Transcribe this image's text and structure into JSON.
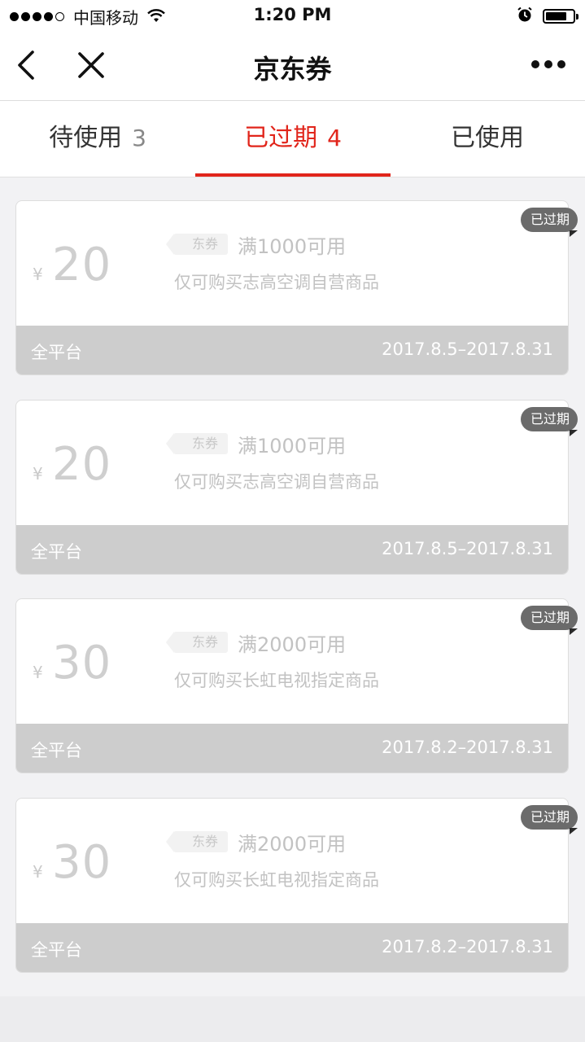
{
  "status_bar": {
    "carrier": "中国移动",
    "time": "1:20 PM"
  },
  "nav": {
    "title": "京东券"
  },
  "tabs": [
    {
      "label": "待使用",
      "count": "3",
      "active": false
    },
    {
      "label": "已过期",
      "count": "4",
      "active": true
    },
    {
      "label": "已使用",
      "count": "",
      "active": false
    }
  ],
  "coupons": [
    {
      "currency": "¥",
      "amount": "20",
      "tag": "东券",
      "condition": "满1000可用",
      "description": "仅可购买志高空调自营商品",
      "platform": "全平台",
      "period": "2017.8.5–2017.8.31",
      "badge": "已过期"
    },
    {
      "currency": "¥",
      "amount": "20",
      "tag": "东券",
      "condition": "满1000可用",
      "description": "仅可购买志高空调自营商品",
      "platform": "全平台",
      "period": "2017.8.5–2017.8.31",
      "badge": "已过期"
    },
    {
      "currency": "¥",
      "amount": "30",
      "tag": "东券",
      "condition": "满2000可用",
      "description": "仅可购买长虹电视指定商品",
      "platform": "全平台",
      "period": "2017.8.2–2017.8.31",
      "badge": "已过期"
    },
    {
      "currency": "¥",
      "amount": "30",
      "tag": "东券",
      "condition": "满2000可用",
      "description": "仅可购买长虹电视指定商品",
      "platform": "全平台",
      "period": "2017.8.2–2017.8.31",
      "badge": "已过期"
    }
  ],
  "colors": {
    "accent": "#e1251b",
    "expired_bar": "#cdcdcd",
    "badge": "#6b6b6b"
  }
}
